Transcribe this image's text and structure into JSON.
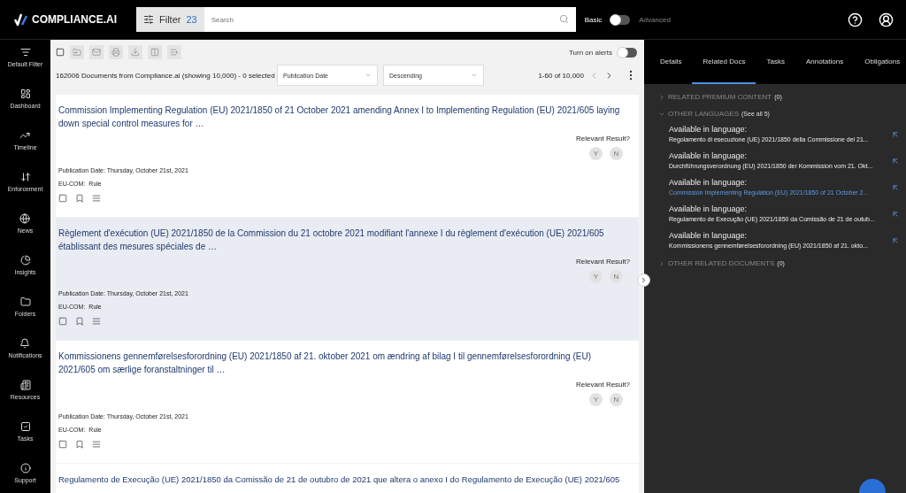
{
  "header": {
    "logo": "COMPLIANCE.AI",
    "filter_label": "Filter",
    "filter_count": "23",
    "search": {
      "placeholder": "Search"
    },
    "mode_left": "Basic",
    "mode_right": "Advanced",
    "advanced": false
  },
  "sidebar": {
    "items": [
      {
        "label": "Default Filter"
      },
      {
        "label": "Dashboard"
      },
      {
        "label": "Timeline"
      },
      {
        "label": "Enforcement"
      },
      {
        "label": "News"
      },
      {
        "label": "Insights"
      },
      {
        "label": "Folders"
      },
      {
        "label": "Notifications"
      },
      {
        "label": "Resources"
      },
      {
        "label": "Tasks"
      },
      {
        "label": "Support"
      }
    ]
  },
  "list": {
    "all_selected": false,
    "alerts_label": "Turn on alerts",
    "alerts_on": false,
    "summary": "162006 Documents from Compliance.ai (showing 10,000) - 0 selected",
    "sort_field": "Publication Date",
    "sort_order": "Descending",
    "pagination": "1-60 of 10,000",
    "documents": [
      {
        "title": "Commission Implementing Regulation (EU) 2021/1850 of 21 October 2021 amending Annex I to Implementing Regulation (EU) 2021/605 laying down special control measures for …",
        "selected": false,
        "checked": false,
        "relevant_label": "Relevant Result?",
        "yes": "Y",
        "no": "N",
        "date": "Publication Date: Thursday, October 21st, 2021",
        "source": "EU-COM:",
        "type": "Rule"
      },
      {
        "title": "Règlement d'exécution (UE) 2021/1850 de la Commission du 21 octobre 2021 modifiant l'annexe I du règlement d'exécution (UE) 2021/605 établissant des mesures spéciales de …",
        "selected": true,
        "checked": false,
        "relevant_label": "Relevant Result?",
        "yes": "Y",
        "no": "N",
        "date": "Publication Date: Thursday, October 21st, 2021",
        "source": "EU-COM:",
        "type": "Rule"
      },
      {
        "title": "Kommissionens gennemførelsesforordning (EU) 2021/1850 af 21. oktober 2021 om ændring af bilag I til gennemførelsesforordning (EU) 2021/605 om særlige foranstaltninger til …",
        "selected": false,
        "checked": false,
        "relevant_label": "Relevant Result?",
        "yes": "Y",
        "no": "N",
        "date": "Publication Date: Thursday, October 21st, 2021",
        "source": "EU-COM:",
        "type": "Rule"
      },
      {
        "title": "Regulamento de Execução (UE) 2021/1850 da Comissão de 21 de outubro de 2021 que altera o anexo I do Regulamento de Execução (UE) 2021/605",
        "selected": false
      }
    ]
  },
  "panel": {
    "tabs": [
      {
        "label": "Details",
        "selected": false
      },
      {
        "label": "Related Docs",
        "selected": true
      },
      {
        "label": "Tasks",
        "selected": false
      },
      {
        "label": "Annotations",
        "selected": false
      },
      {
        "label": "Obligations",
        "selected": false
      }
    ],
    "sections": [
      {
        "title": "RELATED PREMIUM CONTENT",
        "count": "(0)",
        "expanded": false
      },
      {
        "title": "OTHER LANGUAGES",
        "count": "(See all 5)",
        "expanded": true,
        "items": [
          {
            "label": "Available in language:",
            "title": "Regolamento di esecuzione (UE) 2021/1850 della Commissione del 21...",
            "selected": false
          },
          {
            "label": "Available in language:",
            "title": "Durchführungsverordnung (EU) 2021/1850 der Kommission vom 21. Okt...",
            "selected": false
          },
          {
            "label": "Available in language:",
            "title": "Commission Implementing Regulation (EU) 2021/1850 of 21 October 2...",
            "selected": true
          },
          {
            "label": "Available in language:",
            "title": "Regulamento de Execução (UE) 2021/1850 da Comissão de 21 de outub...",
            "selected": false
          },
          {
            "label": "Available in language:",
            "title": "Kommissionens gennemførelsesforordning (EU) 2021/1850 af 21. okto...",
            "selected": false
          }
        ]
      },
      {
        "title": "OTHER RELATED DOCUMENTS",
        "count": "(0)",
        "expanded": false
      }
    ]
  }
}
